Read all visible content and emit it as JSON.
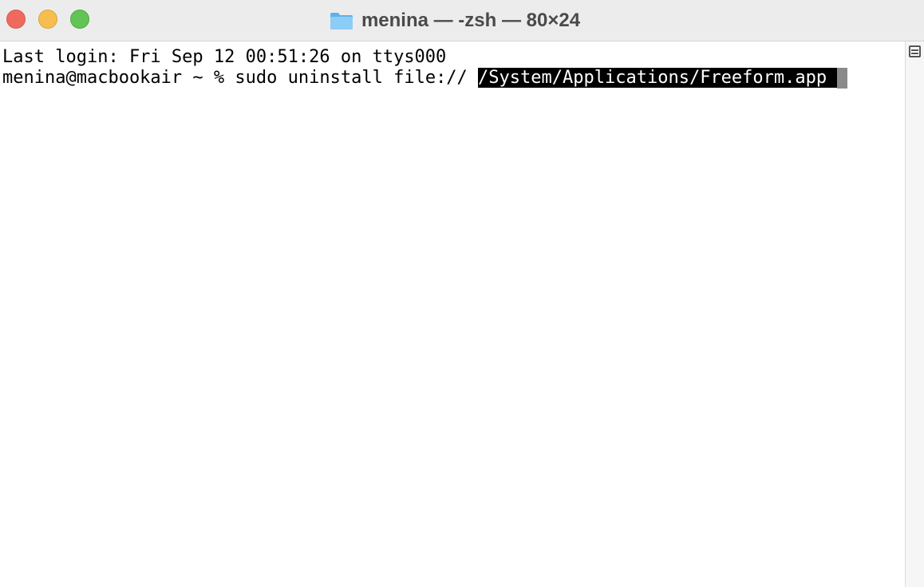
{
  "window": {
    "title": "menina — -zsh — 80×24",
    "title_icon": "folder-icon"
  },
  "terminal": {
    "line1": "Last login: Fri Sep 12 00:51:26 on ttys000",
    "prompt": "menina@macbookair ~ % ",
    "command": "sudo uninstall file:// ",
    "selected_path": "/System/Applications/Freeform.app "
  },
  "colors": {
    "close": "#ee6a5f",
    "minimize": "#f5be4f",
    "maximize": "#61c454",
    "folder": "#7cc1f2",
    "selection_bg": "#000000",
    "cursor": "#8a8a8a"
  }
}
